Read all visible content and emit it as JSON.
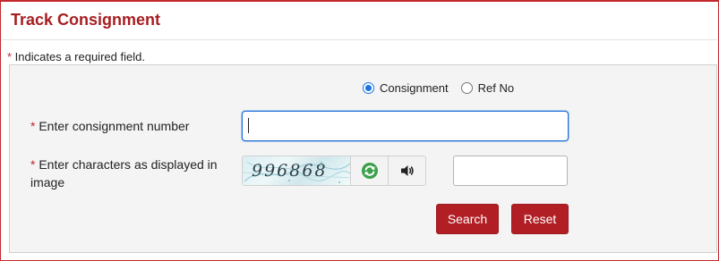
{
  "header": {
    "title": "Track Consignment"
  },
  "required_note": {
    "star": "*",
    "text": " Indicates a required field."
  },
  "search_type": {
    "options": [
      {
        "label": "Consignment",
        "checked": true
      },
      {
        "label": "Ref No",
        "checked": false
      }
    ]
  },
  "fields": {
    "consignment": {
      "star": "*",
      "label": " Enter consignment number",
      "value": ""
    },
    "captcha": {
      "star": "*",
      "label": " Enter characters as displayed in image",
      "image_text": "996868",
      "value": "",
      "refresh_icon": "refresh-icon",
      "audio_icon": "speaker-icon"
    }
  },
  "buttons": {
    "search_label": "Search",
    "reset_label": "Reset"
  },
  "colors": {
    "brand": "#b11f25",
    "title": "#a61e22",
    "focus": "#1e6fd9"
  }
}
